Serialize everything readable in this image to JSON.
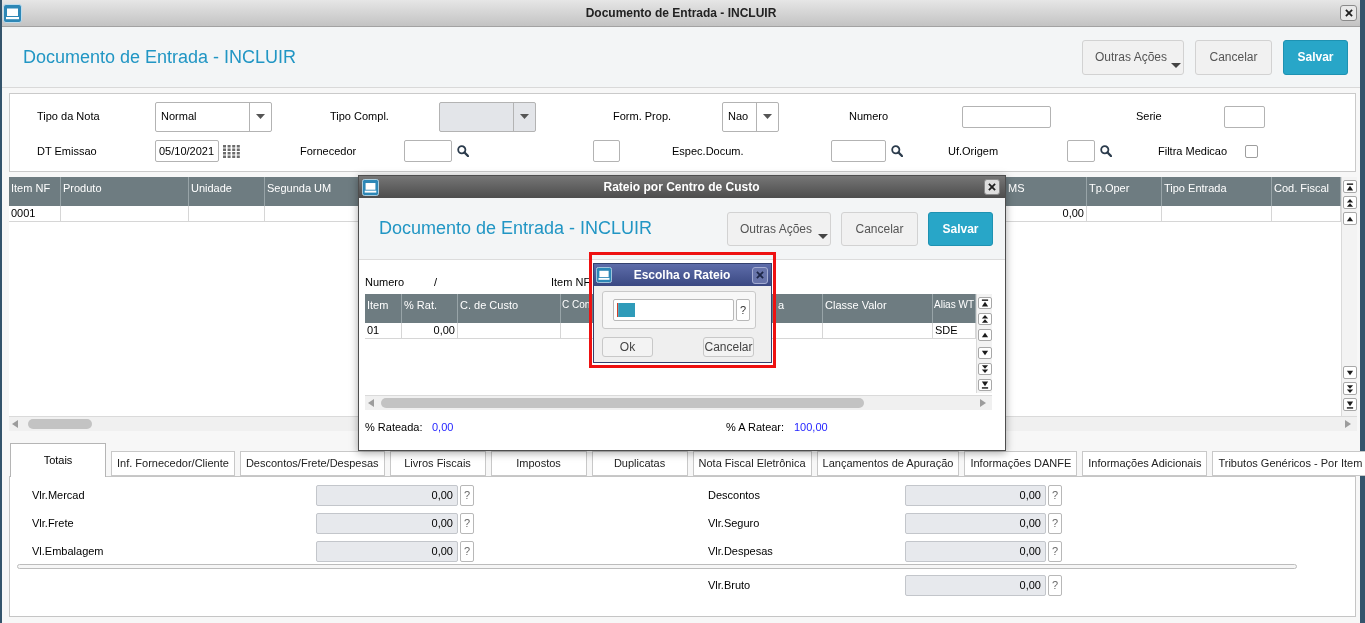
{
  "window": {
    "title": "Documento de Entrada - INCLUIR"
  },
  "header": {
    "title": "Documento de Entrada - INCLUIR",
    "buttons": [
      {
        "label": "Outras Ações",
        "kind": "menu"
      },
      {
        "label": "Cancelar",
        "kind": "secondary"
      },
      {
        "label": "Salvar",
        "kind": "primary"
      }
    ]
  },
  "form": {
    "fields": [
      {
        "kind": "select",
        "label": "Tipo da Nota",
        "value": "Normal",
        "disabled": false
      },
      {
        "kind": "select",
        "label": "Tipo Compl.",
        "disabled": true
      },
      {
        "kind": "select",
        "label": "Form. Prop.",
        "value": "Nao",
        "disabled": false
      },
      {
        "kind": "text",
        "label": "Numero"
      },
      {
        "kind": "text",
        "label": "Serie"
      },
      {
        "kind": "date",
        "label": "DT Emissao",
        "value": "05/10/2021"
      },
      {
        "kind": "lookup",
        "label": "Fornecedor"
      },
      {
        "kind": "text"
      },
      {
        "kind": "lookup",
        "label": "Espec.Docum."
      },
      {
        "kind": "lookup",
        "label": "Uf.Origem"
      },
      {
        "kind": "checkbox",
        "label": "Filtra Medicao",
        "checked": false
      }
    ]
  },
  "table": {
    "columns": [
      {
        "label": "Item NF",
        "kind": "text"
      },
      {
        "label": "Produto",
        "kind": "text"
      },
      {
        "label": "Unidade",
        "kind": "text"
      },
      {
        "label": "Segunda UM",
        "kind": "text"
      },
      {
        "label": "MS",
        "kind": "number"
      },
      {
        "label": "Tp.Oper",
        "kind": "text"
      },
      {
        "label": "Tipo Entrada",
        "kind": "text"
      },
      {
        "label": "Cod. Fiscal",
        "kind": "text"
      }
    ],
    "rows": [
      {
        "cells": [
          "0001",
          null,
          null,
          null,
          "0,00",
          null,
          null,
          null
        ]
      }
    ]
  },
  "dialog": {
    "title": "Rateio por Centro de Custo",
    "header": {
      "title": "Documento de Entrada - INCLUIR",
      "buttons": [
        {
          "label": "Outras Ações",
          "kind": "menu"
        },
        {
          "label": "Cancelar",
          "kind": "secondary"
        },
        {
          "label": "Salvar",
          "kind": "primary"
        }
      ]
    },
    "fields": [
      {
        "label": "Numero",
        "value": "/"
      },
      {
        "label": "Item NF"
      }
    ],
    "table": {
      "columns": [
        {
          "label": "Item",
          "kind": "text"
        },
        {
          "label": "% Rat.",
          "kind": "number"
        },
        {
          "label": "C. de Custo",
          "kind": "text"
        },
        {
          "label": "C Con",
          "kind": "text"
        },
        {
          "label": "a",
          "kind": "text"
        },
        {
          "label": "Classe Valor",
          "kind": "text"
        },
        {
          "label": "Alias WT",
          "kind": "text"
        }
      ],
      "rows": [
        {
          "cells": [
            "01",
            "0,00",
            null,
            null,
            null,
            null,
            "SDE"
          ]
        }
      ]
    },
    "summary": [
      {
        "label": "% Rateada:",
        "value": "0,00"
      },
      {
        "label": "% A Ratear:",
        "value": "100,00"
      }
    ]
  },
  "chooser": {
    "title": "Escolha o Rateio",
    "highlighted": true,
    "help": "?",
    "buttons": [
      {
        "label": "Ok"
      },
      {
        "label": "Cancelar"
      }
    ]
  },
  "tabs": [
    {
      "label": "Totais",
      "selected": true
    },
    {
      "label": "Inf. Fornecedor/Cliente",
      "selected": false
    },
    {
      "label": "Descontos/Frete/Despesas",
      "selected": false
    },
    {
      "label": "Livros Fiscais",
      "selected": false
    },
    {
      "label": "Impostos",
      "selected": false
    },
    {
      "label": "Duplicatas",
      "selected": false
    },
    {
      "label": "Nota Fiscal Eletrônica",
      "selected": false
    },
    {
      "label": "Lançamentos de Apuração",
      "selected": false
    },
    {
      "label": "Informações DANFE",
      "selected": false
    },
    {
      "label": "Informações Adicionais",
      "selected": false
    },
    {
      "label": "Tributos Genéricos - Por Item",
      "selected": false
    }
  ],
  "totals": {
    "left": [
      {
        "label": "Vlr.Mercad",
        "value": "0,00",
        "help": "?"
      },
      {
        "label": "Vlr.Frete",
        "value": "0,00",
        "help": "?"
      },
      {
        "label": "Vl.Embalagem",
        "value": "0,00",
        "help": "?"
      }
    ],
    "right": [
      {
        "label": "Descontos",
        "value": "0,00",
        "help": "?"
      },
      {
        "label": "Vlr.Seguro",
        "value": "0,00",
        "help": "?"
      },
      {
        "label": "Vlr.Despesas",
        "value": "0,00",
        "help": "?"
      }
    ],
    "total": {
      "label": "Vlr.Bruto",
      "value": "0,00",
      "help": "?"
    }
  }
}
